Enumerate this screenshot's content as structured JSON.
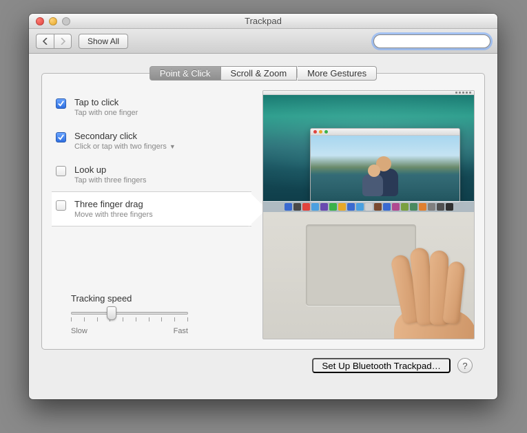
{
  "window": {
    "title": "Trackpad",
    "show_all": "Show All",
    "search_placeholder": ""
  },
  "tabs": [
    {
      "label": "Point & Click",
      "selected": true
    },
    {
      "label": "Scroll & Zoom",
      "selected": false
    },
    {
      "label": "More Gestures",
      "selected": false
    }
  ],
  "options": [
    {
      "title": "Tap to click",
      "sub": "Tap with one finger",
      "checked": true,
      "dropdown": false,
      "selected": false
    },
    {
      "title": "Secondary click",
      "sub": "Click or tap with two fingers",
      "checked": true,
      "dropdown": true,
      "selected": false
    },
    {
      "title": "Look up",
      "sub": "Tap with three fingers",
      "checked": false,
      "dropdown": false,
      "selected": false
    },
    {
      "title": "Three finger drag",
      "sub": "Move with three fingers",
      "checked": false,
      "dropdown": false,
      "selected": true
    }
  ],
  "tracking": {
    "label": "Tracking speed",
    "slow": "Slow",
    "fast": "Fast",
    "value": 3,
    "max": 9
  },
  "footer": {
    "setup": "Set Up Bluetooth Trackpad…",
    "help": "?"
  },
  "dock_colors": [
    "#3a6ad0",
    "#4a4a4a",
    "#e0443e",
    "#4aa0e0",
    "#6a4ab0",
    "#3bb14a",
    "#e6a828",
    "#3a6ad0",
    "#4aa0e0",
    "#d0d0d0",
    "#7a4a30",
    "#3a6ad0",
    "#b04a90",
    "#7aa040",
    "#4a8a60",
    "#e08030",
    "#808080",
    "#505050",
    "#303030"
  ]
}
